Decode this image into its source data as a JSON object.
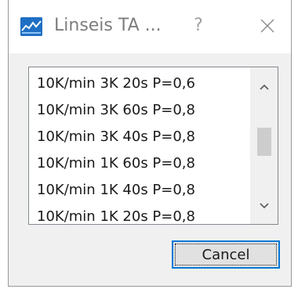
{
  "window": {
    "title": "Linseis TA ...",
    "help_glyph": "?",
    "close_icon": "close-icon",
    "app_icon": "linseis-app-icon",
    "accent_color": "#0078d7"
  },
  "list": {
    "items": [
      "10K/min 3K 20s P=0,6",
      "10K/min 3K 60s P=0,8",
      "10K/min 3K 40s P=0,8",
      "10K/min 1K 60s P=0,8",
      "10K/min 1K 40s P=0,8",
      "10K/min 1K 20s P=0,8"
    ],
    "scroll_up_icon": "chevron-up-icon",
    "scroll_down_icon": "chevron-down-icon"
  },
  "buttons": {
    "cancel_label": "Cancel"
  }
}
